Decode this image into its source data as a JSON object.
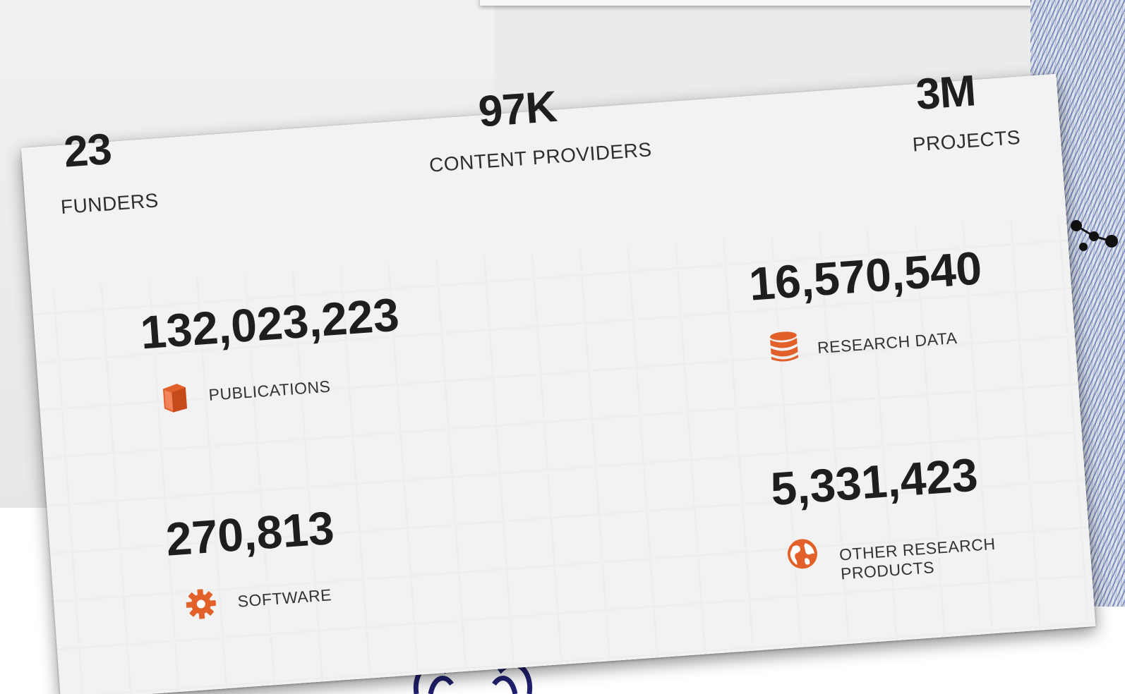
{
  "stats_top": [
    {
      "value": "23",
      "label": "FUNDERS"
    },
    {
      "value": "97K",
      "label": "CONTENT PROVIDERS"
    },
    {
      "value": "3M",
      "label": "PROJECTS"
    }
  ],
  "stats_main": [
    {
      "value": "132,023,223",
      "label": "PUBLICATIONS",
      "icon": "book-icon"
    },
    {
      "value": "16,570,540",
      "label": "RESEARCH DATA",
      "icon": "database-icon"
    },
    {
      "value": "270,813",
      "label": "SOFTWARE",
      "icon": "gear-icon"
    },
    {
      "value": "5,331,423",
      "label": "OTHER RESEARCH PRODUCTS",
      "icon": "globe-icon"
    }
  ],
  "colors": {
    "accent": "#e2612a",
    "text": "#1e1e1e"
  }
}
